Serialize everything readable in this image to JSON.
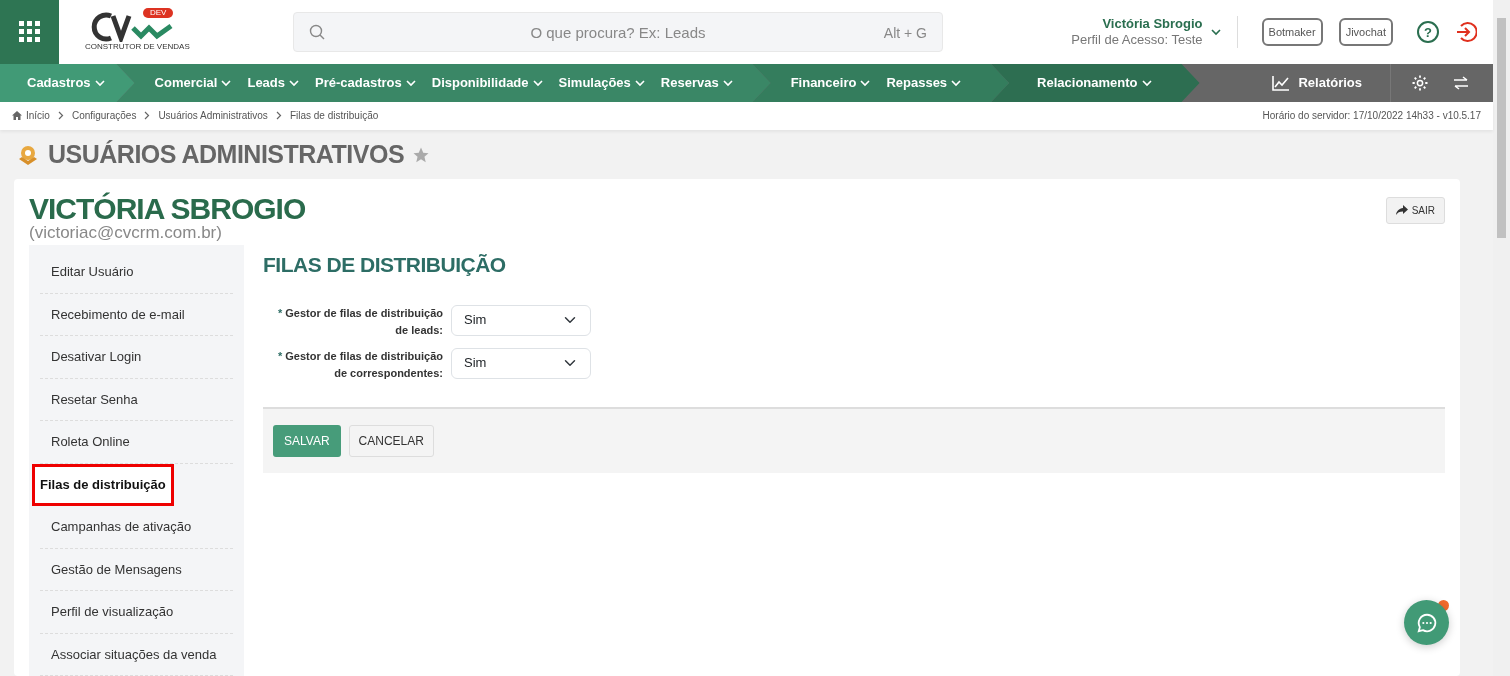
{
  "header": {
    "logo_badge": "DEV",
    "logo_tagline": "CONSTRUTOR DE VENDAS",
    "search": {
      "placeholder": "O que procura? Ex: Leads",
      "shortcut": "Alt + G"
    },
    "user": {
      "name": "Victória Sbrogio",
      "profile": "Perfil de Acesso: Teste"
    },
    "buttons": [
      "Botmaker",
      "Jivochat"
    ],
    "help": "?"
  },
  "nav": {
    "groups": [
      {
        "color": "#419a76",
        "items": [
          "Cadastros"
        ]
      },
      {
        "color": "#3a8766",
        "items": [
          "Comercial",
          "Leads",
          "Pré-cadastros",
          "Disponibilidade",
          "Simulações",
          "Reservas"
        ]
      },
      {
        "color": "#347d5d",
        "items": [
          "Financeiro",
          "Repasses"
        ]
      },
      {
        "color": "#2d6e51",
        "items": [
          "Relacionamento"
        ]
      }
    ],
    "reports": "Relatórios"
  },
  "breadcrumb": [
    "Início",
    "Configurações",
    "Usuários Administrativos",
    "Filas de distribuição"
  ],
  "server_info": "Horário do servidor: 17/10/2022 14h33 - v10.5.17",
  "page_title": "USUÁRIOS ADMINISTRATIVOS",
  "user_card": {
    "name": "VICTÓRIA SBROGIO",
    "email": "(victoriac@cvcrm.com.br)",
    "exit_button": "SAIR"
  },
  "menu": [
    {
      "label": "Editar Usuário",
      "selected": false,
      "highlighted": false
    },
    {
      "label": "Recebimento de e-mail",
      "selected": false,
      "highlighted": false
    },
    {
      "label": "Desativar Login",
      "selected": false,
      "highlighted": false
    },
    {
      "label": "Resetar Senha",
      "selected": false,
      "highlighted": false
    },
    {
      "label": "Roleta Online",
      "selected": false,
      "highlighted": false
    },
    {
      "label": "Filas de distribuição",
      "selected": true,
      "highlighted": true
    },
    {
      "label": "Campanhas de ativação",
      "selected": false,
      "highlighted": false
    },
    {
      "label": "Gestão de Mensagens",
      "selected": false,
      "highlighted": false
    },
    {
      "label": "Perfil de visualização",
      "selected": false,
      "highlighted": false
    },
    {
      "label": "Associar situações da venda",
      "selected": false,
      "highlighted": false
    }
  ],
  "form": {
    "title": "FILAS DE DISTRIBUIÇÃO",
    "fields": [
      {
        "required_mark": "*",
        "label": "Gestor de filas de distribuição de leads:",
        "value": "Sim"
      },
      {
        "required_mark": "*",
        "label": "Gestor de filas de distribuição de correspondentes:",
        "value": "Sim"
      }
    ],
    "buttons": [
      {
        "label": "SALVAR",
        "kind": "primary"
      },
      {
        "label": "CANCELAR",
        "kind": "secondary"
      }
    ]
  },
  "chat": {
    "unread": true
  }
}
